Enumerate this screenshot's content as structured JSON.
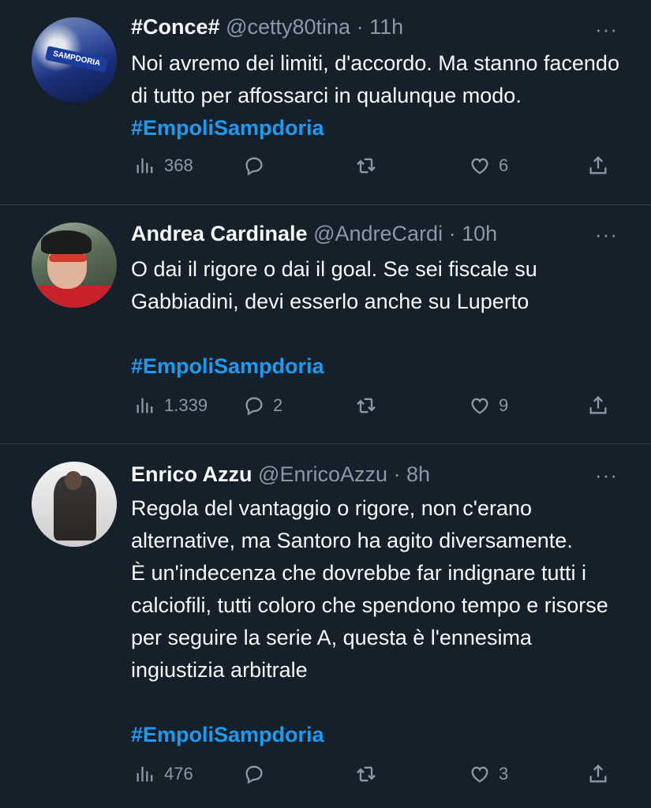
{
  "tweets": [
    {
      "name": "#Conce#",
      "handle": "@cetty80tina",
      "dot": "·",
      "time": "11h",
      "more": "···",
      "text": "Noi avremo dei limiti, d'accordo. Ma stanno facendo di tutto per affossarci in qualunque modo. ",
      "hashtag": "#EmpoliSampdoria",
      "views": "368",
      "replies": "",
      "retweets": "",
      "likes": "6",
      "avatar_text": "SAMPDORIA"
    },
    {
      "name": "Andrea Cardinale",
      "handle": "@AndreCardi",
      "dot": "·",
      "time": "10h",
      "more": "···",
      "text": "O dai il rigore o dai il goal. Se sei fiscale su Gabbiadini, devi esserlo anche su Luperto",
      "hashtag": "#EmpoliSampdoria",
      "views": "1.339",
      "replies": "2",
      "retweets": "",
      "likes": "9"
    },
    {
      "name": "Enrico Azzu",
      "handle": "@EnricoAzzu",
      "dot": "·",
      "time": "8h",
      "more": "···",
      "text": "Regola del vantaggio o rigore, non c'erano alternative, ma Santoro ha agito diversamente.\nÈ un'indecenza che dovrebbe far indignare tutti i calciofili, tutti coloro che spendono tempo e risorse per seguire la serie A, questa è l'ennesima ingiustizia arbitrale",
      "hashtag": "#EmpoliSampdoria",
      "views": "476",
      "replies": "",
      "retweets": "",
      "likes": "3"
    }
  ],
  "icons": [
    "views-icon",
    "reply-icon",
    "retweet-icon",
    "like-icon",
    "share-icon",
    "more-icon"
  ],
  "colors": {
    "background": "#15202b",
    "text": "#f7f9f9",
    "muted": "#8b98a5",
    "accent": "#1d9bf0",
    "divider": "#38444d"
  }
}
